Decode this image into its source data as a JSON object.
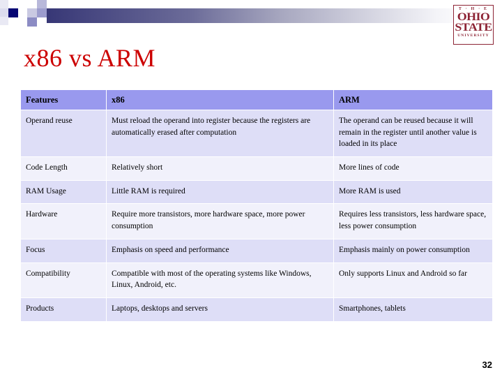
{
  "slide": {
    "title": "x86 vs ARM",
    "page_number": "32",
    "title_color": "#cc0000",
    "header_gradient_from": "#2c2c6e",
    "header_gradient_to": "#ffffff",
    "table_header_bg": "#9999ee",
    "row_shade_bg": "#dedef7",
    "row_light_bg": "#f1f1fb"
  },
  "logo": {
    "line1": "T · H · E",
    "line2": "OHIO",
    "line3": "STATE",
    "line4": "UNIVERSITY",
    "color": "#8d2435"
  },
  "table": {
    "headers": [
      "Features",
      "x86",
      "ARM"
    ],
    "rows": [
      {
        "feature": "Operand reuse",
        "x86": "Must reload the operand into register because the registers are automatically erased after computation",
        "arm": "The operand can be reused because it will remain in the register until another value is loaded in its place"
      },
      {
        "feature": "Code Length",
        "x86": "Relatively short",
        "arm": "More lines of code"
      },
      {
        "feature": "RAM Usage",
        "x86": "Little RAM is required",
        "arm": "More RAM is used"
      },
      {
        "feature": "Hardware",
        "x86": "Require more transistors, more hardware space, more power consumption",
        "arm": "Requires less transistors, less hardware space, less power consumption"
      },
      {
        "feature": "Focus",
        "x86": "Emphasis on speed and performance",
        "arm": "Emphasis mainly on power consumption"
      },
      {
        "feature": "Compatibility",
        "x86": "Compatible with most of the operating systems like Windows, Linux, Android, etc.",
        "arm": "Only supports Linux and Android so far"
      },
      {
        "feature": "Products",
        "x86": "Laptops, desktops and servers",
        "arm": "Smartphones, tablets"
      }
    ]
  }
}
